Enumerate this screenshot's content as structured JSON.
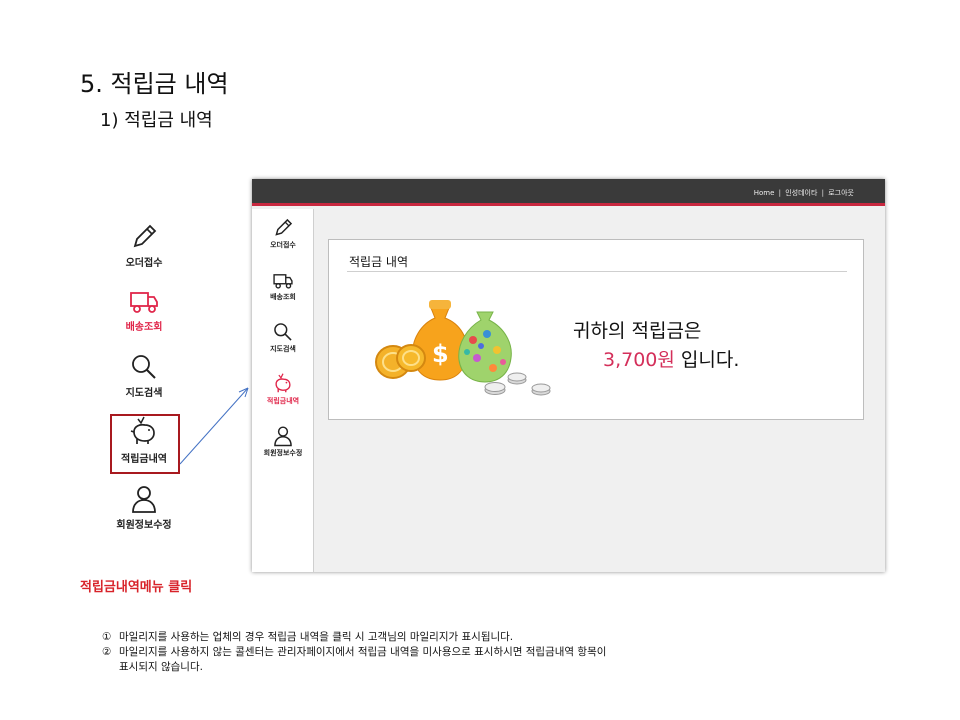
{
  "slide": {
    "title": "5. 적립금 내역",
    "subtitle": "1) 적립금 내역"
  },
  "menu": {
    "items": [
      {
        "label": "오더접수",
        "icon": "pencil-icon"
      },
      {
        "label": "배송조회",
        "icon": "truck-icon"
      },
      {
        "label": "지도검색",
        "icon": "search-icon"
      },
      {
        "label": "적립금내역",
        "icon": "piggy-bank-icon"
      },
      {
        "label": "회원정보수정",
        "icon": "user-icon"
      }
    ],
    "active_color": "#e0264a"
  },
  "caption": "적립금내역메뉴 클릭",
  "window": {
    "topnav": [
      "Home",
      "인성데이타",
      "로그아웃"
    ],
    "topnav_sep": "|",
    "box_title": "적립금 내역",
    "message_line1": "귀하의 적립금은",
    "amount": "3,700원",
    "message_suffix": "입니다."
  },
  "notes": [
    {
      "num": "①",
      "text": "마일리지를 사용하는 업체의 경우 적립금 내역을 클릭 시 고객님의 마일리지가 표시됩니다."
    },
    {
      "num": "②",
      "text": "마일리지를 사용하지 않는 콜센터는 관리자페이지에서 적립금 내역을 미사용으로 표시하시면 적립금내역 항목이"
    },
    {
      "num": "",
      "text": "표시되지 않습니다."
    }
  ],
  "colors": {
    "accent": "#c8283f",
    "highlight_box": "#a8191f",
    "caption": "#d8232a"
  }
}
